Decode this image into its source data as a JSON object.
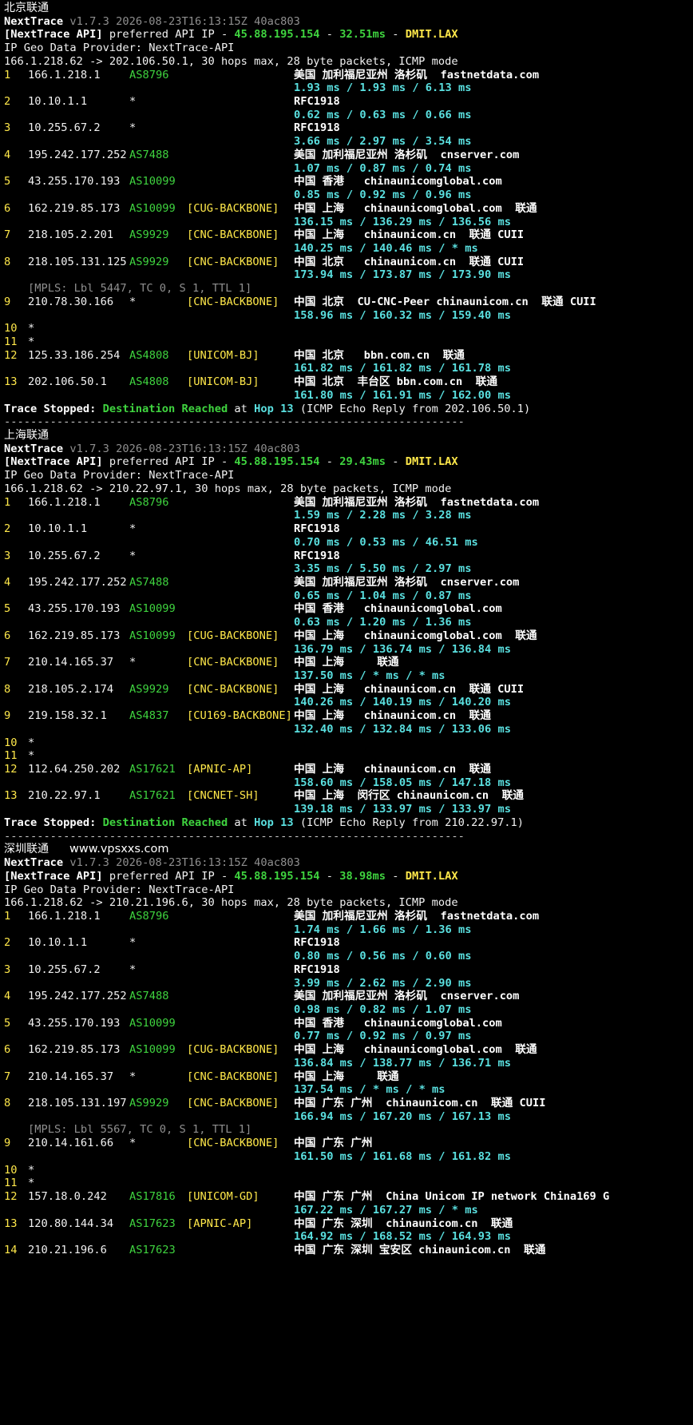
{
  "hops_meta": {
    "max_hops": 30,
    "packet_bytes": 28,
    "mode": "ICMP mode"
  },
  "colors": {
    "background": "#000000",
    "text": "#f2f2f2",
    "green": "#3fd43f",
    "yellow": "#ffe84a",
    "cyan": "#5ae0e0",
    "gray": "#8f8f8f"
  },
  "sections": [
    {
      "title": "北京联通",
      "watermark": "",
      "tool": "NextTrace",
      "version_line": "v1.7.3 2026-08-23T16:13:15Z 40ac803",
      "api_prefix": "[NextTrace API]",
      "api_text": " preferred API IP - ",
      "api_ip": "45.88.195.154",
      "api_dash1": " - ",
      "api_latency": "32.51ms",
      "api_dash2": " - ",
      "api_node": "DMIT.LAX",
      "geo_provider": "IP Geo Data Provider: NextTrace-API",
      "route_line": "166.1.218.62 -> 202.106.50.1, 30 hops max, 28 byte packets, ICMP mode",
      "hops": [
        {
          "n": "1",
          "ip": "166.1.218.1",
          "asn": "AS8796",
          "tag": "",
          "geo": "美国 加利福尼亚州 洛杉矶  fastnetdata.com",
          "rtt": "1.93 ms / 1.93 ms / 6.13 ms"
        },
        {
          "n": "2",
          "ip": "10.10.1.1",
          "asn": "*",
          "tag": "",
          "geo": "RFC1918",
          "rtt": "0.62 ms / 0.63 ms / 0.66 ms"
        },
        {
          "n": "3",
          "ip": "10.255.67.2",
          "asn": "*",
          "tag": "",
          "geo": "RFC1918",
          "rtt": "3.66 ms / 2.97 ms / 3.54 ms"
        },
        {
          "n": "4",
          "ip": "195.242.177.252",
          "asn": "AS7488",
          "tag": "",
          "geo": "美国 加利福尼亚州 洛杉矶  cnserver.com",
          "rtt": "1.07 ms / 0.87 ms / 0.74 ms"
        },
        {
          "n": "5",
          "ip": "43.255.170.193",
          "asn": "AS10099",
          "tag": "",
          "geo": "中国 香港   chinaunicomglobal.com",
          "rtt": "0.85 ms / 0.92 ms / 0.96 ms"
        },
        {
          "n": "6",
          "ip": "162.219.85.173",
          "asn": "AS10099",
          "tag": "[CUG-BACKBONE]",
          "geo": "中国 上海   chinaunicomglobal.com  联通",
          "rtt": "136.15 ms / 136.29 ms / 136.56 ms"
        },
        {
          "n": "7",
          "ip": "218.105.2.201",
          "asn": "AS9929",
          "tag": "[CNC-BACKBONE]",
          "geo": "中国 上海   chinaunicom.cn  联通 CUII",
          "rtt": "140.25 ms / 140.46 ms / * ms"
        },
        {
          "n": "8",
          "ip": "218.105.131.125",
          "asn": "AS9929",
          "tag": "[CNC-BACKBONE]",
          "geo": "中国 北京   chinaunicom.cn  联通 CUII",
          "rtt": "173.94 ms / 173.87 ms / 173.90 ms",
          "mpls": "[MPLS: Lbl 5447, TC 0, S 1, TTL 1]"
        },
        {
          "n": "9",
          "ip": "210.78.30.166",
          "asn": "*",
          "tag": "[CNC-BACKBONE]",
          "geo": "中国 北京  CU-CNC-Peer chinaunicom.cn  联通 CUII",
          "rtt": "158.96 ms / 160.32 ms / 159.40 ms"
        },
        {
          "n": "10",
          "ip": "*",
          "asn": "",
          "tag": "",
          "geo": "",
          "rtt": ""
        },
        {
          "n": "11",
          "ip": "*",
          "asn": "",
          "tag": "",
          "geo": "",
          "rtt": ""
        },
        {
          "n": "12",
          "ip": "125.33.186.254",
          "asn": "AS4808",
          "tag": "[UNICOM-BJ]",
          "geo": "中国 北京   bbn.com.cn  联通",
          "rtt": "161.82 ms / 161.82 ms / 161.78 ms"
        },
        {
          "n": "13",
          "ip": "202.106.50.1",
          "asn": "AS4808",
          "tag": "[UNICOM-BJ]",
          "geo": "中国 北京  丰台区 bbn.com.cn  联通",
          "rtt": "161.80 ms / 161.91 ms / 162.00 ms"
        }
      ],
      "stop_prefix": "Trace Stopped: ",
      "stop_status": "Destination Reached",
      "stop_at": " at ",
      "stop_hop": "Hop 13",
      "stop_tail": " (ICMP Echo Reply from 202.106.50.1)"
    },
    {
      "title": "上海联通",
      "watermark": "",
      "tool": "NextTrace",
      "version_line": "v1.7.3 2026-08-23T16:13:15Z 40ac803",
      "api_prefix": "[NextTrace API]",
      "api_text": " preferred API IP - ",
      "api_ip": "45.88.195.154",
      "api_dash1": " - ",
      "api_latency": "29.43ms",
      "api_dash2": " - ",
      "api_node": "DMIT.LAX",
      "geo_provider": "IP Geo Data Provider: NextTrace-API",
      "route_line": "166.1.218.62 -> 210.22.97.1, 30 hops max, 28 byte packets, ICMP mode",
      "hops": [
        {
          "n": "1",
          "ip": "166.1.218.1",
          "asn": "AS8796",
          "tag": "",
          "geo": "美国 加利福尼亚州 洛杉矶  fastnetdata.com",
          "rtt": "1.59 ms / 2.28 ms / 3.28 ms"
        },
        {
          "n": "2",
          "ip": "10.10.1.1",
          "asn": "*",
          "tag": "",
          "geo": "RFC1918",
          "rtt": "0.70 ms / 0.53 ms / 46.51 ms"
        },
        {
          "n": "3",
          "ip": "10.255.67.2",
          "asn": "*",
          "tag": "",
          "geo": "RFC1918",
          "rtt": "3.35 ms / 5.50 ms / 2.97 ms"
        },
        {
          "n": "4",
          "ip": "195.242.177.252",
          "asn": "AS7488",
          "tag": "",
          "geo": "美国 加利福尼亚州 洛杉矶  cnserver.com",
          "rtt": "0.65 ms / 1.04 ms / 0.87 ms"
        },
        {
          "n": "5",
          "ip": "43.255.170.193",
          "asn": "AS10099",
          "tag": "",
          "geo": "中国 香港   chinaunicomglobal.com",
          "rtt": "0.63 ms / 1.20 ms / 1.36 ms"
        },
        {
          "n": "6",
          "ip": "162.219.85.173",
          "asn": "AS10099",
          "tag": "[CUG-BACKBONE]",
          "geo": "中国 上海   chinaunicomglobal.com  联通",
          "rtt": "136.79 ms / 136.74 ms / 136.84 ms"
        },
        {
          "n": "7",
          "ip": "210.14.165.37",
          "asn": "*",
          "tag": "[CNC-BACKBONE]",
          "geo": "中国 上海     联通",
          "rtt": "137.50 ms / * ms / * ms"
        },
        {
          "n": "8",
          "ip": "218.105.2.174",
          "asn": "AS9929",
          "tag": "[CNC-BACKBONE]",
          "geo": "中国 上海   chinaunicom.cn  联通 CUII",
          "rtt": "140.26 ms / 140.19 ms / 140.20 ms"
        },
        {
          "n": "9",
          "ip": "219.158.32.1",
          "asn": "AS4837",
          "tag": "[CU169-BACKBONE]",
          "geo": "中国 上海   chinaunicom.cn  联通",
          "rtt": "132.40 ms / 132.84 ms / 133.06 ms"
        },
        {
          "n": "10",
          "ip": "*",
          "asn": "",
          "tag": "",
          "geo": "",
          "rtt": ""
        },
        {
          "n": "11",
          "ip": "*",
          "asn": "",
          "tag": "",
          "geo": "",
          "rtt": ""
        },
        {
          "n": "12",
          "ip": "112.64.250.202",
          "asn": "AS17621",
          "tag": "[APNIC-AP]",
          "geo": "中国 上海   chinaunicom.cn  联通",
          "rtt": "158.60 ms / 158.05 ms / 147.18 ms"
        },
        {
          "n": "13",
          "ip": "210.22.97.1",
          "asn": "AS17621",
          "tag": "[CNCNET-SH]",
          "geo": "中国 上海  闵行区 chinaunicom.cn  联通",
          "rtt": "139.18 ms / 133.97 ms / 133.97 ms"
        }
      ],
      "stop_prefix": "Trace Stopped: ",
      "stop_status": "Destination Reached",
      "stop_at": " at ",
      "stop_hop": "Hop 13",
      "stop_tail": " (ICMP Echo Reply from 210.22.97.1)"
    },
    {
      "title": "深圳联通",
      "watermark": "www.vpsxxs.com",
      "tool": "NextTrace",
      "version_line": "v1.7.3 2026-08-23T16:13:15Z 40ac803",
      "api_prefix": "[NextTrace API]",
      "api_text": " preferred API IP - ",
      "api_ip": "45.88.195.154",
      "api_dash1": " - ",
      "api_latency": "38.98ms",
      "api_dash2": " - ",
      "api_node": "DMIT.LAX",
      "geo_provider": "IP Geo Data Provider: NextTrace-API",
      "route_line": "166.1.218.62 -> 210.21.196.6, 30 hops max, 28 byte packets, ICMP mode",
      "hops": [
        {
          "n": "1",
          "ip": "166.1.218.1",
          "asn": "AS8796",
          "tag": "",
          "geo": "美国 加利福尼亚州 洛杉矶  fastnetdata.com",
          "rtt": "1.74 ms / 1.66 ms / 1.36 ms"
        },
        {
          "n": "2",
          "ip": "10.10.1.1",
          "asn": "*",
          "tag": "",
          "geo": "RFC1918",
          "rtt": "0.80 ms / 0.56 ms / 0.60 ms"
        },
        {
          "n": "3",
          "ip": "10.255.67.2",
          "asn": "*",
          "tag": "",
          "geo": "RFC1918",
          "rtt": "3.99 ms / 2.62 ms / 2.90 ms"
        },
        {
          "n": "4",
          "ip": "195.242.177.252",
          "asn": "AS7488",
          "tag": "",
          "geo": "美国 加利福尼亚州 洛杉矶  cnserver.com",
          "rtt": "0.98 ms / 0.82 ms / 1.07 ms"
        },
        {
          "n": "5",
          "ip": "43.255.170.193",
          "asn": "AS10099",
          "tag": "",
          "geo": "中国 香港   chinaunicomglobal.com",
          "rtt": "0.77 ms / 0.92 ms / 0.97 ms"
        },
        {
          "n": "6",
          "ip": "162.219.85.173",
          "asn": "AS10099",
          "tag": "[CUG-BACKBONE]",
          "geo": "中国 上海   chinaunicomglobal.com  联通",
          "rtt": "136.84 ms / 138.77 ms / 136.71 ms"
        },
        {
          "n": "7",
          "ip": "210.14.165.37",
          "asn": "*",
          "tag": "[CNC-BACKBONE]",
          "geo": "中国 上海     联通",
          "rtt": "137.54 ms / * ms / * ms"
        },
        {
          "n": "8",
          "ip": "218.105.131.197",
          "asn": "AS9929",
          "tag": "[CNC-BACKBONE]",
          "geo": "中国 广东 广州  chinaunicom.cn  联通 CUII",
          "rtt": "166.94 ms / 167.20 ms / 167.13 ms",
          "mpls": "[MPLS: Lbl 5567, TC 0, S 1, TTL 1]"
        },
        {
          "n": "9",
          "ip": "210.14.161.66",
          "asn": "*",
          "tag": "[CNC-BACKBONE]",
          "geo": "中国 广东 广州",
          "rtt": "161.50 ms / 161.68 ms / 161.82 ms"
        },
        {
          "n": "10",
          "ip": "*",
          "asn": "",
          "tag": "",
          "geo": "",
          "rtt": ""
        },
        {
          "n": "11",
          "ip": "*",
          "asn": "",
          "tag": "",
          "geo": "",
          "rtt": ""
        },
        {
          "n": "12",
          "ip": "157.18.0.242",
          "asn": "AS17816",
          "tag": "[UNICOM-GD]",
          "geo": "中国 广东 广州  China Unicom IP network China169 G",
          "rtt": "167.22 ms / 167.27 ms / * ms"
        },
        {
          "n": "13",
          "ip": "120.80.144.34",
          "asn": "AS17623",
          "tag": "[APNIC-AP]",
          "geo": "中国 广东 深圳  chinaunicom.cn  联通",
          "rtt": "164.92 ms / 168.52 ms / 164.93 ms"
        },
        {
          "n": "14",
          "ip": "210.21.196.6",
          "asn": "AS17623",
          "tag": "",
          "geo": "中国 广东 深圳 宝安区 chinaunicom.cn  联通",
          "rtt": ""
        }
      ],
      "stop_prefix": "",
      "stop_status": "",
      "stop_at": "",
      "stop_hop": "",
      "stop_tail": ""
    }
  ],
  "separator": "----------------------------------------------------------------------"
}
